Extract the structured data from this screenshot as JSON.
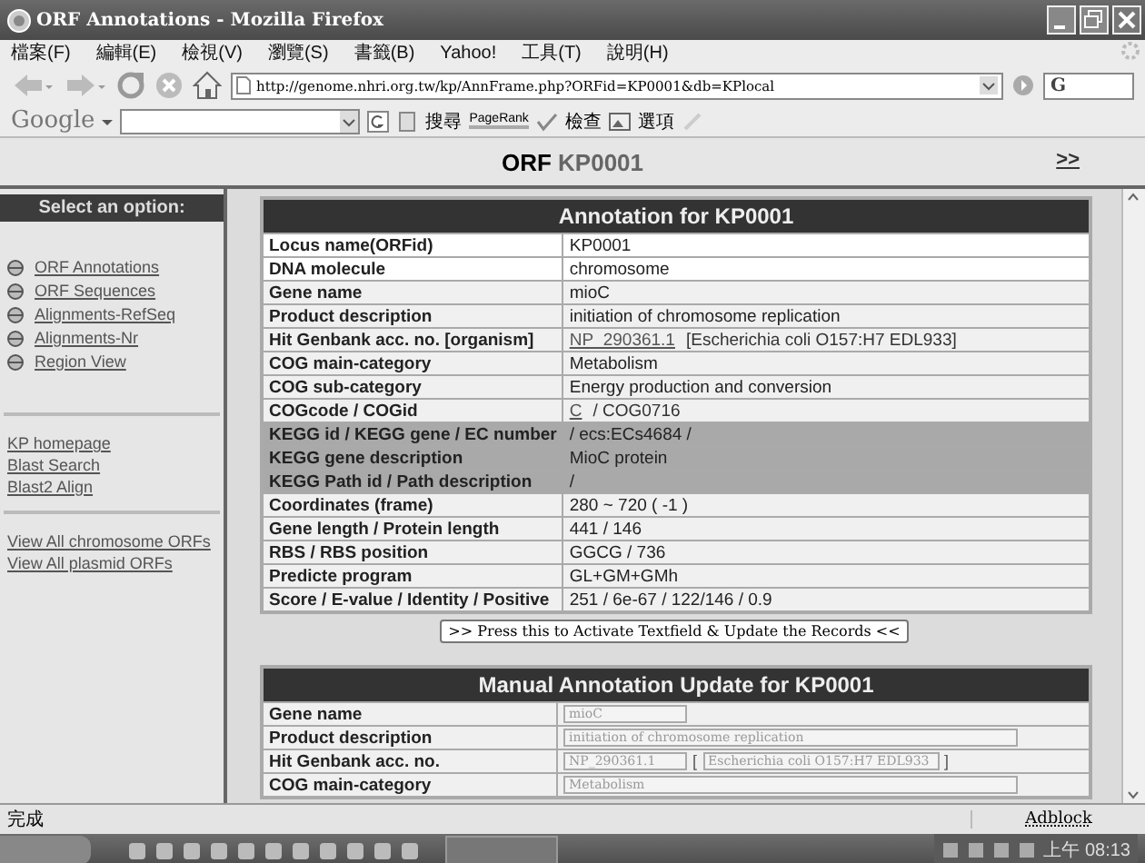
{
  "window": {
    "title": "ORF Annotations - Mozilla Firefox"
  },
  "menu": [
    "檔案(F)",
    "編輯(E)",
    "檢視(V)",
    "瀏覽(S)",
    "書籤(B)",
    "Yahoo!",
    "工具(T)",
    "說明(H)"
  ],
  "address": {
    "value": "http://genome.nhri.org.tw/kp/AnnFrame.php?ORFid=KP0001&db=KPlocal"
  },
  "search": {
    "value": "G"
  },
  "google_toolbar": {
    "label": "Google",
    "items": [
      "搜尋",
      "PageRank",
      "檢查",
      "選項"
    ]
  },
  "header": {
    "prefix": "ORF",
    "id": "KP0001",
    "next": ">>"
  },
  "sidebar": {
    "title": "Select an option:",
    "options": [
      {
        "label": "ORF Annotations"
      },
      {
        "label": "ORF Sequences"
      },
      {
        "label": "Alignments-RefSeq"
      },
      {
        "label": "Alignments-Nr"
      },
      {
        "label": "Region View"
      }
    ],
    "links": [
      "KP homepage",
      "Blast Search",
      "Blast2 Align"
    ],
    "view_links": [
      "View All chromosome ORFs",
      "View All plasmid ORFs"
    ]
  },
  "annotation": {
    "title": "Annotation for KP0001",
    "rows": [
      {
        "label": "Locus name(ORFid)",
        "kind": "plain",
        "value": [
          {
            "text": "KP0001",
            "link": false
          }
        ]
      },
      {
        "label": "DNA molecule",
        "kind": "plain",
        "value": [
          {
            "text": "chromosome",
            "link": false
          }
        ]
      },
      {
        "label": "Gene name",
        "kind": "shaded",
        "value": [
          {
            "text": "mioC",
            "link": false
          }
        ]
      },
      {
        "label": "Product description",
        "kind": "shaded",
        "value": [
          {
            "text": "initiation of chromosome replication",
            "link": false
          }
        ]
      },
      {
        "label": "Hit Genbank acc. no. [organism]",
        "kind": "shaded",
        "value": [
          {
            "text": "NP_290361.1",
            "link": true
          },
          {
            "text": "[Escherichia coli O157:H7 EDL933]",
            "link": false
          }
        ]
      },
      {
        "label": "COG main-category",
        "kind": "shaded",
        "value": [
          {
            "text": "Metabolism",
            "link": false
          }
        ]
      },
      {
        "label": "COG sub-category",
        "kind": "shaded",
        "value": [
          {
            "text": "Energy production and conversion",
            "link": false
          }
        ]
      },
      {
        "label": "COGcode / COGid",
        "kind": "shaded",
        "value": [
          {
            "text": "C",
            "link": true
          },
          {
            "text": "/ COG0716",
            "link": false
          }
        ]
      },
      {
        "label": "KEGG id / KEGG gene / EC number",
        "kind": "kegg",
        "value": [
          {
            "text": "/ ecs:ECs4684 /",
            "link": false
          }
        ]
      },
      {
        "label": "KEGG gene description",
        "kind": "kegg",
        "value": [
          {
            "text": "MioC protein",
            "link": false
          }
        ]
      },
      {
        "label": "KEGG Path id / Path description",
        "kind": "kegg",
        "value": [
          {
            "text": "/",
            "link": false
          }
        ]
      },
      {
        "label": "Coordinates (frame)",
        "kind": "shaded",
        "value": [
          {
            "text": "280 ~ 720 ( -1 )",
            "link": false
          }
        ]
      },
      {
        "label": "Gene length / Protein length",
        "kind": "shaded",
        "value": [
          {
            "text": "441 / 146",
            "link": false
          }
        ]
      },
      {
        "label": "RBS / RBS position",
        "kind": "shaded",
        "value": [
          {
            "text": "GGCG / 736",
            "link": false
          }
        ]
      },
      {
        "label": "Predicte program",
        "kind": "shaded",
        "value": [
          {
            "text": "GL+GM+GMh",
            "link": false
          }
        ]
      },
      {
        "label": "Score / E-value / Identity / Positive",
        "kind": "shaded",
        "value": [
          {
            "text": "251 / 6e-67 / 122/146 / 0.9",
            "link": false
          }
        ]
      }
    ]
  },
  "activate_button": ">> Press this to Activate Textfield & Update the Records <<",
  "manual": {
    "title": "Manual Annotation Update for KP0001",
    "rows": [
      {
        "label": "Gene name",
        "fields": [
          {
            "value": "mioC",
            "disabled": true
          }
        ]
      },
      {
        "label": "Product description",
        "fields": [
          {
            "value": "initiation of chromosome replication",
            "disabled": true
          }
        ]
      },
      {
        "label": "Hit Genbank acc. no.",
        "fields": [
          {
            "value": "NP_290361.1",
            "disabled": true
          },
          {
            "value": "Escherichia coli O157:H7 EDL933",
            "disabled": true
          }
        ],
        "brackets": [
          "[",
          "]"
        ]
      },
      {
        "label": "COG main-category",
        "fields": [
          {
            "value": "Metabolism",
            "disabled": true
          }
        ]
      }
    ]
  },
  "status_bar": {
    "text": "完成",
    "addon": "Adblock"
  },
  "taskbar": {
    "clock": "上午 08:13"
  }
}
